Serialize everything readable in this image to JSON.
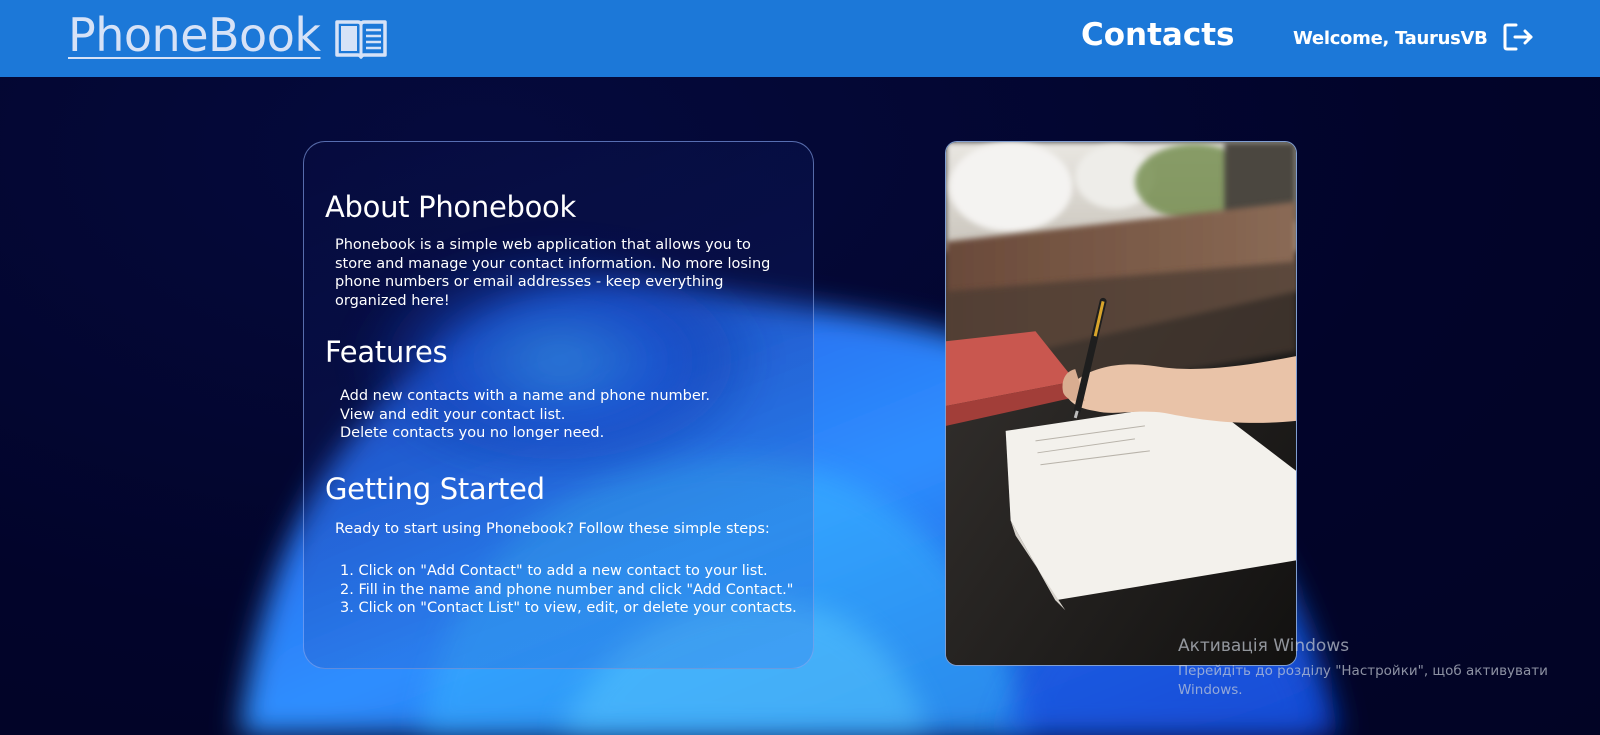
{
  "header": {
    "logo_text": "PhoneBook",
    "nav_contacts": "Contacts",
    "welcome_text": "Welcome, TaurusVB",
    "colors": {
      "bar": "#1c78d8",
      "logo": "#d6e2f7"
    },
    "icons": {
      "logo": "open-book-icon",
      "logout": "logout-icon"
    }
  },
  "about": {
    "title": "About Phonebook",
    "text_lines": [
      "Phonebook is a simple web application that allows you to",
      "store and manage your contact information. No more losing",
      "phone numbers or email addresses - keep everything",
      "organized here!"
    ]
  },
  "features": {
    "title": "Features",
    "items": [
      "Add new contacts with a name and phone number.",
      "View and edit your contact list.",
      "Delete contacts you no longer need."
    ]
  },
  "getting_started": {
    "title": "Getting Started",
    "intro": "Ready to start using Phonebook? Follow these simple steps:",
    "steps": [
      "1. Click on \"Add Contact\" to add a new contact to your list.",
      "2. Fill in the name and phone number and click \"Add Contact.\"",
      "3. Click on \"Contact List\" to view, edit, or delete your contacts."
    ]
  },
  "watermark": {
    "title": "Активація Windows",
    "line1": "Перейдіть до розділу \"Настройки\", щоб активувати",
    "line2": "Windows."
  },
  "colors": {
    "background": "#03052e",
    "accent_blue": "#1c78d8"
  }
}
